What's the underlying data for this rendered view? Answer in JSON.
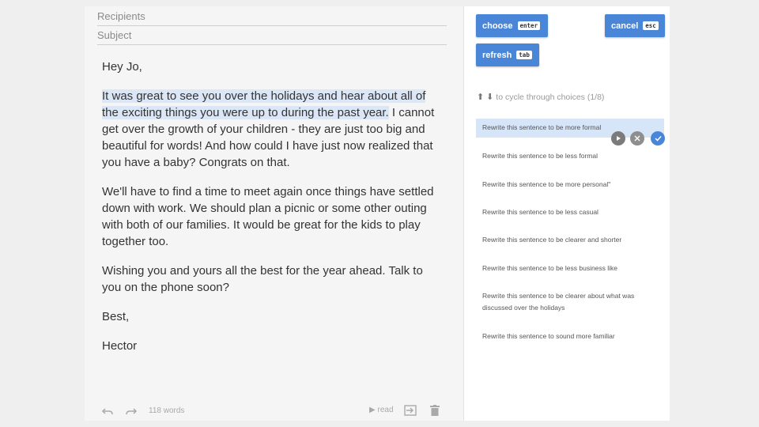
{
  "compose": {
    "recipients_placeholder": "Recipients",
    "subject_placeholder": "Subject",
    "greeting": "Hey Jo,",
    "p1_highlighted": "It was great to see you over the holidays and hear about all of the exciting things you were up to during the past year.",
    "p1_rest": " I cannot get over the growth of your children - they are just too big and beautiful for words! And how could I have just now realized that you have a baby? Congrats on that.",
    "p2": "We'll have to find a time to meet again once things have settled down with work. We should plan a picnic or some other outing with both of our families. It would be great for the kids to play together too.",
    "p3": "Wishing you and yours all the best for the year ahead. Talk to you on the phone soon?",
    "closing": "Best,",
    "signature": "Hector"
  },
  "footer": {
    "word_count": "118 words",
    "read_label": "read",
    "icons": [
      "undo-icon",
      "redo-icon",
      "play-icon",
      "insert-icon",
      "trash-icon"
    ]
  },
  "panel": {
    "choose": {
      "label": "choose",
      "key": "enter"
    },
    "cancel": {
      "label": "cancel",
      "key": "esc"
    },
    "refresh": {
      "label": "refresh",
      "key": "tab"
    },
    "hint": "to cycle through choices (1/8)",
    "accent": "#4a86d8",
    "choices": [
      "Rewrite this sentence to be more formal",
      "Rewrite this sentence to be less formal",
      "Rewrite this sentence to be more personal\"",
      "Rewrite this sentence to be less casual",
      "Rewrite this sentence to be clearer and shorter",
      "Rewrite this sentence to be less business like",
      "Rewrite this sentence to be clearer about what was discussed over the holidays",
      "Rewrite this sentence to sound more familiar"
    ]
  }
}
